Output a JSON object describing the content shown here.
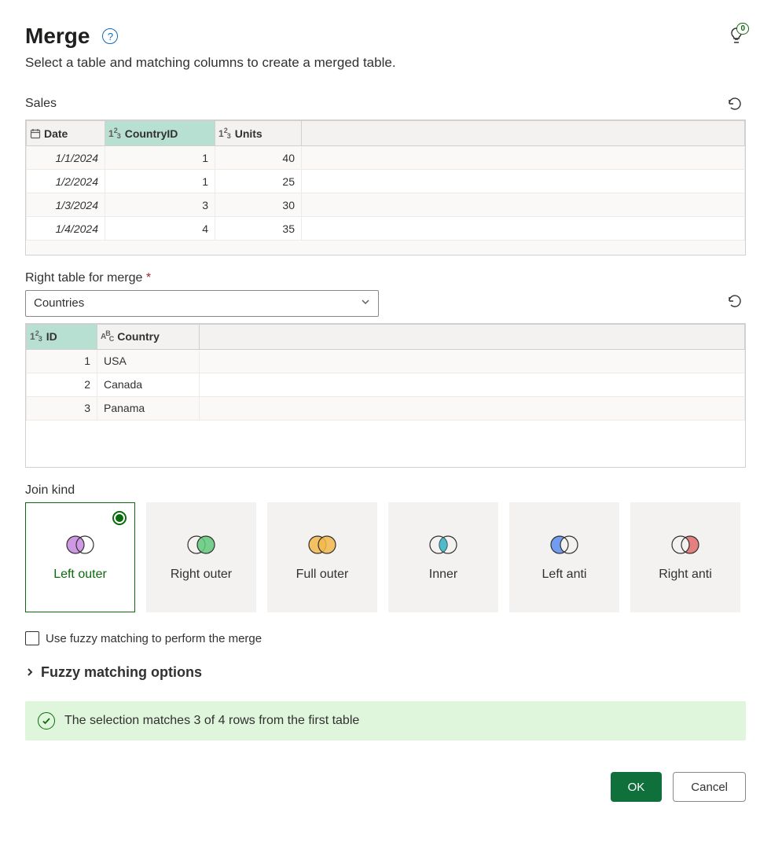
{
  "header": {
    "title": "Merge",
    "description": "Select a table and matching columns to create a merged table.",
    "tip_badge": "0"
  },
  "left_table": {
    "name": "Sales",
    "columns": [
      "Date",
      "CountryID",
      "Units"
    ],
    "rows": [
      {
        "date": "1/1/2024",
        "countryid": "1",
        "units": "40"
      },
      {
        "date": "1/2/2024",
        "countryid": "1",
        "units": "25"
      },
      {
        "date": "1/3/2024",
        "countryid": "3",
        "units": "30"
      },
      {
        "date": "1/4/2024",
        "countryid": "4",
        "units": "35"
      }
    ]
  },
  "right_table": {
    "label": "Right table for merge",
    "selected": "Countries",
    "columns": [
      "ID",
      "Country"
    ],
    "rows": [
      {
        "id": "1",
        "country": "USA"
      },
      {
        "id": "2",
        "country": "Canada"
      },
      {
        "id": "3",
        "country": "Panama"
      }
    ]
  },
  "join": {
    "label": "Join kind",
    "options": [
      "Left outer",
      "Right outer",
      "Full outer",
      "Inner",
      "Left anti",
      "Right anti"
    ],
    "selected": "Left outer"
  },
  "fuzzy": {
    "checkbox_label": "Use fuzzy matching to perform the merge",
    "section_label": "Fuzzy matching options"
  },
  "notice": {
    "text": "The selection matches 3 of 4 rows from the first table"
  },
  "footer": {
    "ok": "OK",
    "cancel": "Cancel"
  }
}
